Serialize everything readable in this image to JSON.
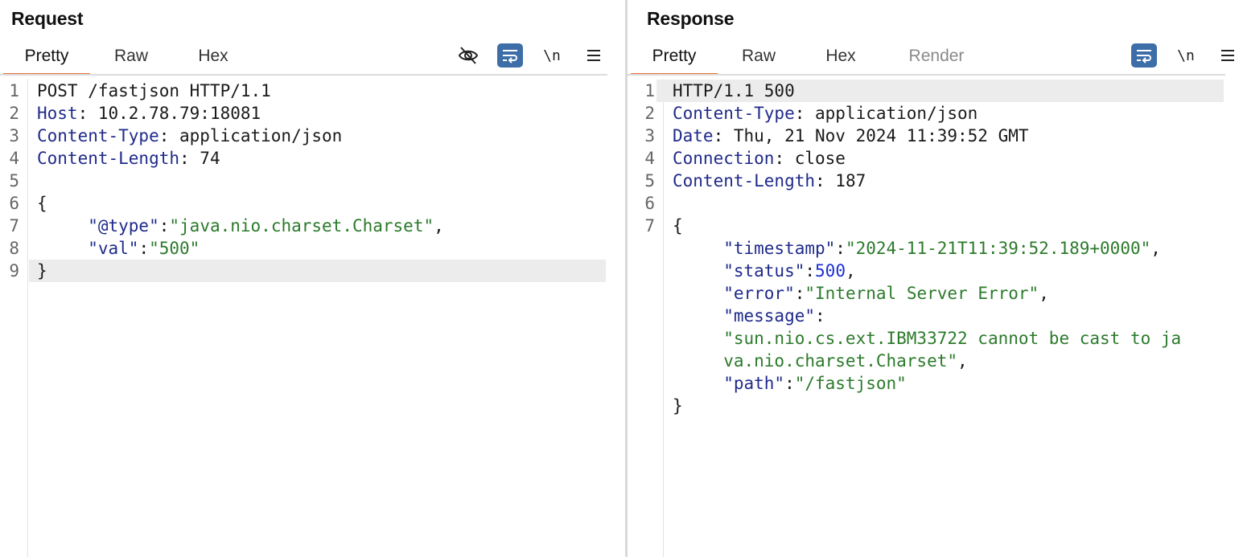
{
  "request": {
    "title": "Request",
    "tabs": [
      "Pretty",
      "Raw",
      "Hex"
    ],
    "active_tab": "Pretty",
    "toolbar": {
      "hide_icon": "eye-slash-icon",
      "wrap_icon": "wrap-lines-icon",
      "newline_label": "\\n",
      "menu_icon": "hamburger-menu-icon"
    },
    "lines": [
      {
        "n": "1",
        "parts": [
          [
            "p",
            "POST /fastjson HTTP/1.1"
          ]
        ]
      },
      {
        "n": "2",
        "parts": [
          [
            "k",
            "Host"
          ],
          [
            "p",
            ": 10.2.78.79:18081"
          ]
        ]
      },
      {
        "n": "3",
        "parts": [
          [
            "k",
            "Content-Type"
          ],
          [
            "p",
            ": application/json"
          ]
        ]
      },
      {
        "n": "4",
        "parts": [
          [
            "k",
            "Content-Length"
          ],
          [
            "p",
            ": 74"
          ]
        ]
      },
      {
        "n": "5",
        "parts": []
      },
      {
        "n": "6",
        "parts": [
          [
            "p",
            "{"
          ]
        ]
      },
      {
        "n": "7",
        "parts": [
          [
            "p",
            "     "
          ],
          [
            "k",
            "\"@type\""
          ],
          [
            "p",
            ":"
          ],
          [
            "s",
            "\"java.nio.charset.Charset\""
          ],
          [
            "p",
            ","
          ]
        ]
      },
      {
        "n": "8",
        "parts": [
          [
            "p",
            "     "
          ],
          [
            "k",
            "\"val\""
          ],
          [
            "p",
            ":"
          ],
          [
            "s",
            "\"500\""
          ]
        ]
      },
      {
        "n": "9",
        "parts": [
          [
            "p",
            "}"
          ]
        ],
        "highlight": true
      }
    ]
  },
  "response": {
    "title": "Response",
    "tabs": [
      "Pretty",
      "Raw",
      "Hex",
      "Render"
    ],
    "active_tab": "Pretty",
    "disabled_tabs": [
      "Render"
    ],
    "toolbar": {
      "wrap_icon": "wrap-lines-icon",
      "newline_label": "\\n",
      "menu_icon": "hamburger-menu-icon"
    },
    "lines": [
      {
        "n": "1",
        "parts": [
          [
            "p",
            "HTTP/1.1 500"
          ]
        ],
        "highlight": true
      },
      {
        "n": "2",
        "parts": [
          [
            "k",
            "Content-Type"
          ],
          [
            "p",
            ": application/json"
          ]
        ]
      },
      {
        "n": "3",
        "parts": [
          [
            "k",
            "Date"
          ],
          [
            "p",
            ": Thu, 21 Nov 2024 11:39:52 GMT"
          ]
        ]
      },
      {
        "n": "4",
        "parts": [
          [
            "k",
            "Connection"
          ],
          [
            "p",
            ": close"
          ]
        ]
      },
      {
        "n": "5",
        "parts": [
          [
            "k",
            "Content-Length"
          ],
          [
            "p",
            ": 187"
          ]
        ]
      },
      {
        "n": "6",
        "parts": []
      },
      {
        "n": "7",
        "parts": [
          [
            "p",
            "{"
          ]
        ]
      },
      {
        "n": "",
        "parts": [
          [
            "p",
            "     "
          ],
          [
            "k",
            "\"timestamp\""
          ],
          [
            "p",
            ":"
          ],
          [
            "s",
            "\"2024-11-21T11:39:52.189+0000\""
          ],
          [
            "p",
            ","
          ]
        ]
      },
      {
        "n": "",
        "parts": [
          [
            "p",
            "     "
          ],
          [
            "k",
            "\"status\""
          ],
          [
            "p",
            ":"
          ],
          [
            "n",
            "500"
          ],
          [
            "p",
            ","
          ]
        ]
      },
      {
        "n": "",
        "parts": [
          [
            "p",
            "     "
          ],
          [
            "k",
            "\"error\""
          ],
          [
            "p",
            ":"
          ],
          [
            "s",
            "\"Internal Server Error\""
          ],
          [
            "p",
            ","
          ]
        ]
      },
      {
        "n": "",
        "parts": [
          [
            "p",
            "     "
          ],
          [
            "k",
            "\"message\""
          ],
          [
            "p",
            ":"
          ]
        ]
      },
      {
        "n": "",
        "parts": [
          [
            "p",
            "     "
          ],
          [
            "s",
            "\"sun.nio.cs.ext.IBM33722 cannot be cast to ja"
          ]
        ]
      },
      {
        "n": "",
        "parts": [
          [
            "p",
            "     "
          ],
          [
            "s",
            "va.nio.charset.Charset\""
          ],
          [
            "p",
            ","
          ]
        ]
      },
      {
        "n": "",
        "parts": [
          [
            "p",
            "     "
          ],
          [
            "k",
            "\"path\""
          ],
          [
            "p",
            ":"
          ],
          [
            "s",
            "\"/fastjson\""
          ]
        ]
      },
      {
        "n": "",
        "parts": [
          [
            "p",
            "}"
          ]
        ]
      }
    ]
  },
  "colors": {
    "accent": "#e8743b",
    "toggle_on": "#3d6ea8",
    "key": "#1f2a8a",
    "string": "#2b7a2b",
    "number": "#1a2fd0"
  },
  "corner_controls": [
    "#3d6ea8",
    "#e6e6e6",
    "#e6e6e6"
  ]
}
